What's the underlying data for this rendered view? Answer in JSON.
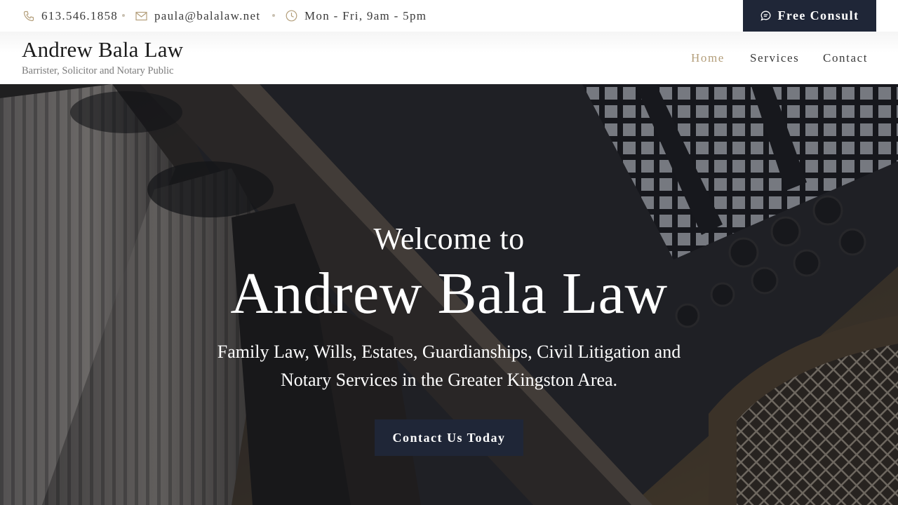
{
  "topbar": {
    "phone": "613.546.1858",
    "email": "paula@balalaw.net",
    "hours": "Mon - Fri, 9am - 5pm",
    "consult_label": "Free Consult"
  },
  "header": {
    "title": "Andrew Bala Law",
    "subtitle": "Barrister, Solicitor and Notary Public",
    "nav": [
      {
        "label": "Home",
        "active": true
      },
      {
        "label": "Services",
        "active": false
      },
      {
        "label": "Contact",
        "active": false
      }
    ]
  },
  "hero": {
    "welcome": "Welcome to",
    "title": "Andrew Bala Law",
    "description": "Family Law, Wills, Estates, Guardianships, Civil Litigation and Notary Services in the Greater Kingston Area.",
    "cta_label": "Contact Us Today"
  },
  "colors": {
    "accent": "#b39e7a",
    "navy": "#1f2637",
    "icon": "#b39e7a"
  },
  "icons": [
    "phone-icon",
    "mail-icon",
    "clock-icon",
    "chat-icon"
  ]
}
